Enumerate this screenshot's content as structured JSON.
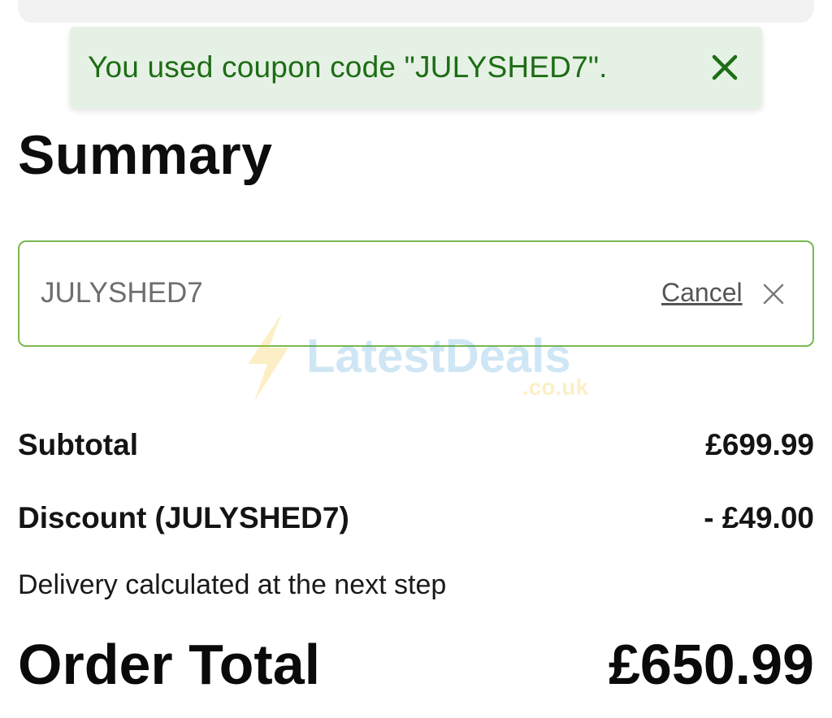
{
  "toast": {
    "message": "You used coupon code \"JULYSHED7\".",
    "close_icon": "close-icon",
    "accent_color": "#1d6d14",
    "background_color": "#e6f1e6"
  },
  "summary": {
    "title": "Summary"
  },
  "coupon": {
    "value": "JULYSHED7",
    "cancel_label": "Cancel",
    "clear_icon": "close-icon",
    "border_color": "#79b84f"
  },
  "watermark": {
    "brand": "LatestDeals",
    "domain": ".co.uk"
  },
  "totals": {
    "subtotal_label": "Subtotal",
    "subtotal_value": "£699.99",
    "discount_label": "Discount (JULYSHED7)",
    "discount_value": "- £49.00",
    "delivery_note": "Delivery calculated at the next step",
    "order_total_label": "Order Total",
    "order_total_value": "£650.99"
  }
}
